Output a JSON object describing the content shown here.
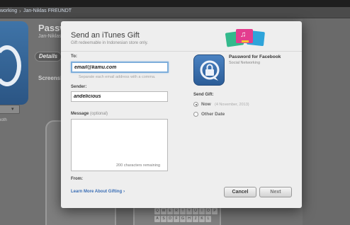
{
  "background": {
    "breadcrumb": [
      "working",
      "Jan-Niklas FREUNDT"
    ],
    "app_title": "Passw",
    "author": "Jan-Niklas",
    "details_tab": "Details",
    "screenshots_label": "Screensh",
    "both_label": "both",
    "keyboard_rows": [
      [
        "Q",
        "W",
        "E",
        "R",
        "T",
        "Y",
        "U",
        "I",
        "O",
        "P"
      ],
      [
        "A",
        "S",
        "D",
        "F",
        "G",
        "H",
        "J",
        "K",
        "L"
      ]
    ]
  },
  "dialog": {
    "title": "Send an iTunes Gift",
    "subtitle": "Gift redeemable in Indonesian store only.",
    "to_label": "To:",
    "to_value": "email@kamu.com",
    "to_hint": "Separate each email address with a comma.",
    "sender_label": "Sender:",
    "sender_value": "andelicious",
    "message_label": "Message",
    "message_optional": "(optional)",
    "characters_remaining": "200 characters remaining",
    "from_label": "From:",
    "learn_more": "Learn More About Gifting",
    "learn_more_chevron": "›",
    "app": {
      "name": "Password for Facebook",
      "category": "Social Networking",
      "icon": "lock-chat-icon"
    },
    "send_gift_label": "Send Gift:",
    "options": [
      {
        "label": "Now",
        "date": "(4 November, 2013)",
        "selected": true
      },
      {
        "label": "Other Date",
        "date": "",
        "selected": false
      }
    ],
    "cancel_label": "Cancel",
    "next_label": "Next",
    "accent_color": "#7eaedb",
    "link_color": "#3a6eb5"
  }
}
